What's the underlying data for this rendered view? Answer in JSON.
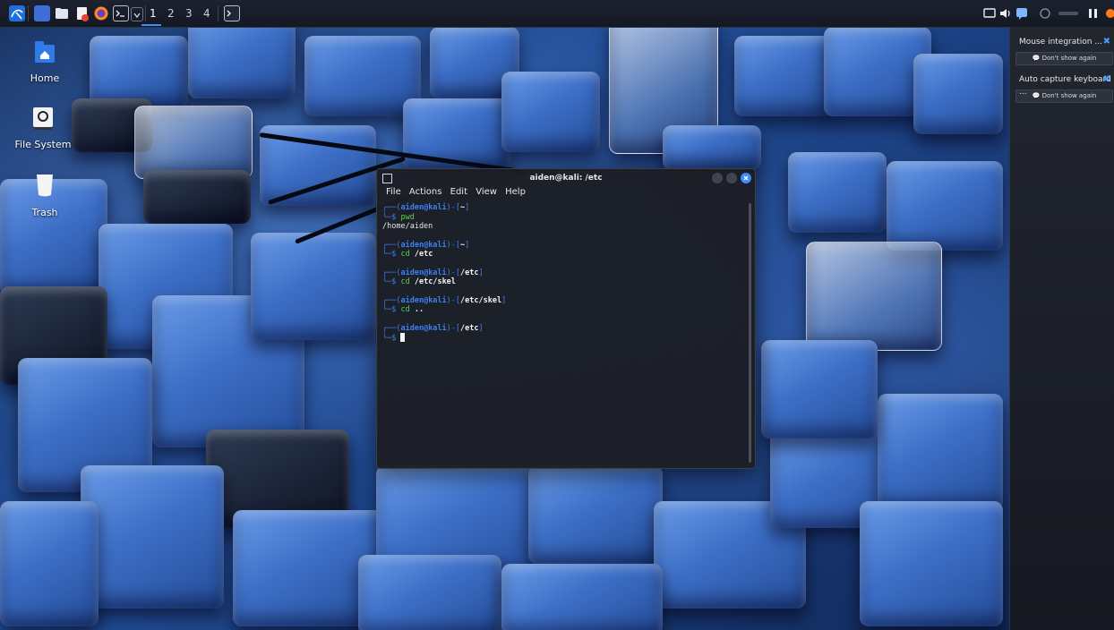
{
  "panel": {
    "workspaces": [
      "1",
      "2",
      "3",
      "4"
    ],
    "active_workspace": "1"
  },
  "desktop_icons": [
    {
      "label": "Home",
      "icon": "home-folder-icon"
    },
    {
      "label": "File System",
      "icon": "drive-icon"
    },
    {
      "label": "Trash",
      "icon": "trash-icon"
    }
  ],
  "notifications": [
    {
      "title": "Mouse integration ...",
      "button": "Don't show again"
    },
    {
      "title": "Auto capture keyboard ...",
      "button": "Don't show again"
    }
  ],
  "terminal": {
    "title": "aiden@kali: /etc",
    "menu": [
      "File",
      "Actions",
      "Edit",
      "View",
      "Help"
    ],
    "blocks": [
      {
        "user": "aiden@kali",
        "cwd": "~",
        "cmd": "pwd",
        "arg": "",
        "output": "/home/aiden"
      },
      {
        "user": "aiden@kali",
        "cwd": "~",
        "cmd": "cd",
        "arg": "/etc",
        "output": ""
      },
      {
        "user": "aiden@kali",
        "cwd": "/etc",
        "cmd": "cd",
        "arg": "/etc/skel",
        "output": ""
      },
      {
        "user": "aiden@kali",
        "cwd": "/etc/skel",
        "cmd": "cd",
        "arg": "..",
        "output": ""
      },
      {
        "user": "aiden@kali",
        "cwd": "/etc",
        "cmd": "",
        "arg": "",
        "output": ""
      }
    ]
  },
  "colors": {
    "accent": "#3c7ff0",
    "command": "#57d15a",
    "panel": "#141823"
  }
}
